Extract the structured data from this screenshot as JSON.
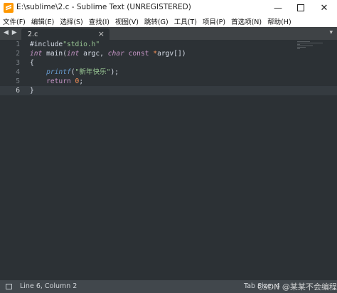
{
  "window": {
    "title": "E:\\sublime\\2.c - Sublime Text (UNREGISTERED)",
    "min_glyph": "—",
    "close_glyph": "✕"
  },
  "menu": [
    "文件(F)",
    "编辑(E)",
    "选择(S)",
    "查找(I)",
    "视图(V)",
    "跳转(G)",
    "工具(T)",
    "项目(P)",
    "首选项(N)",
    "帮助(H)"
  ],
  "tabbar": {
    "nav_arrows": "◀ ▶",
    "tab_label": "2.c",
    "tab_close": "×",
    "dropdown": "▾"
  },
  "editor": {
    "line_numbers": [
      "1",
      "2",
      "3",
      "4",
      "5",
      "6"
    ],
    "active_line": 6
  },
  "code_text": {
    "l1_directive": "#include",
    "l1_string": "\"stdio.h\"",
    "l2_int": "int",
    "l2_main": " main(",
    "l2_int2": "int",
    "l2_argc": " argc, ",
    "l2_char": "char",
    "l2_const": " const ",
    "l2_star": "*",
    "l2_argv": "argv[])",
    "l3": "{",
    "l4_printf": "printf",
    "l4_open": "(",
    "l4_string": "\"新年快乐\"",
    "l4_close": ");",
    "l5_return": "return",
    "l5_zero": "0",
    "l5_semi": ";",
    "l6": "}"
  },
  "statusbar": {
    "position": "Line 6, Column 2",
    "tab_size": "Tab Size: 4"
  },
  "watermark": "CSDN @某某不会编程"
}
